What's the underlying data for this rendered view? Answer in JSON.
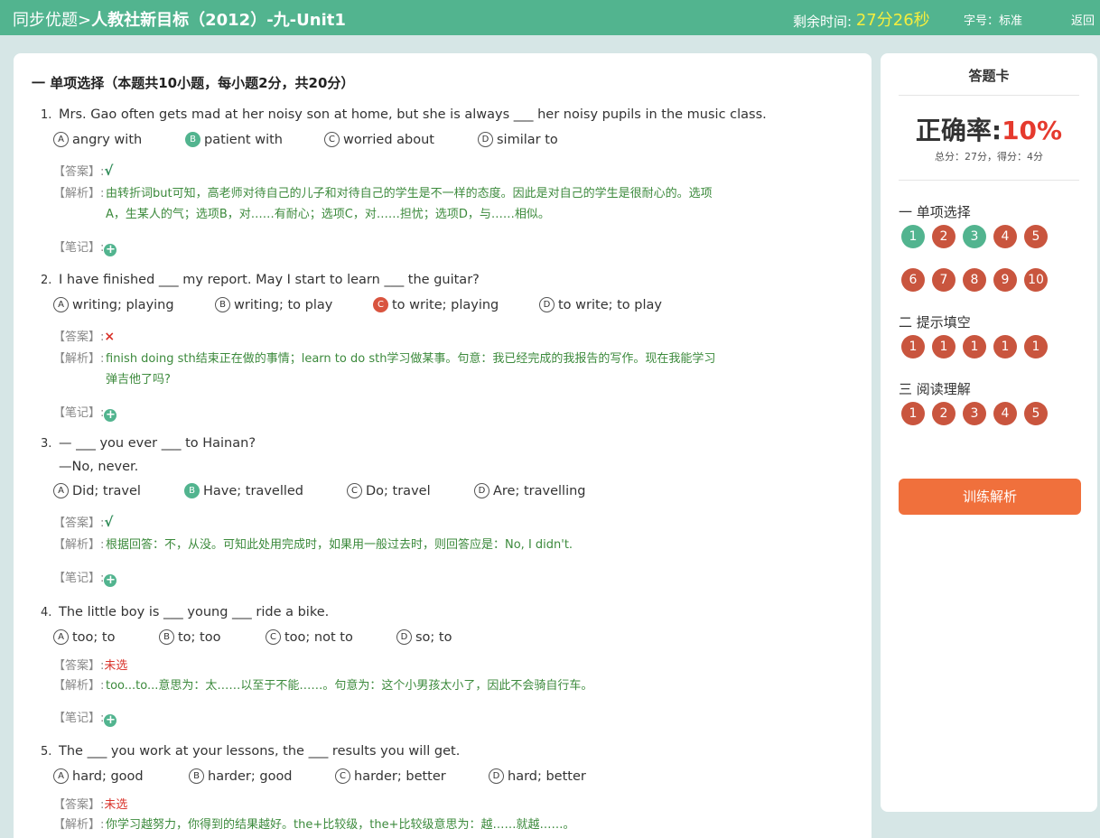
{
  "header": {
    "breadcrumb_prefix": "同步优题>",
    "breadcrumb_title": "人教社新目标（2012）-九-Unit1",
    "timer_label": "剩余时间:",
    "timer_value": "27分26秒",
    "font_size": "字号：标准",
    "back": "返回"
  },
  "section": {
    "title": "一 单项选择（本题共10小题，每小题2分，共20分）"
  },
  "labels": {
    "answer": "【答案】:",
    "analysis": "【解析】:",
    "note": "【笔记】:"
  },
  "questions": [
    {
      "num": "1.",
      "stem": "Mrs. Gao often gets mad at her noisy son at home, but she is always ___ her noisy pupils in the music class.",
      "options": [
        {
          "letter": "A",
          "text": "angry with"
        },
        {
          "letter": "B",
          "text": "patient with"
        },
        {
          "letter": "C",
          "text": "worried about"
        },
        {
          "letter": "D",
          "text": "similar to"
        }
      ],
      "answer": "√",
      "analysis_lines": [
        "由转折词but可知，高老师对待自己的儿子和对待自己的学生是不一样的态度。因此是对自己的学生是很耐心的。选项",
        "A，生某人的气；选项B，对……有耐心；选项C，对……担忧；选项D，与……相似。"
      ]
    },
    {
      "num": "2.",
      "stem": "I have finished ___ my report. May I start to learn ___ the guitar?",
      "options": [
        {
          "letter": "A",
          "text": "writing; playing"
        },
        {
          "letter": "B",
          "text": "writing; to play"
        },
        {
          "letter": "C",
          "text": "to write; playing"
        },
        {
          "letter": "D",
          "text": "to write; to play"
        }
      ],
      "answer": "×",
      "analysis_lines": [
        "finish doing sth结束正在做的事情；learn to do sth学习做某事。句意：我已经完成的我报告的写作。现在我能学习",
        "弹吉他了吗?"
      ]
    },
    {
      "num": "3.",
      "stem": "— ___ you ever ___ to Hainan?",
      "stem2": "—No, never.",
      "options": [
        {
          "letter": "A",
          "text": "Did; travel"
        },
        {
          "letter": "B",
          "text": "Have; travelled"
        },
        {
          "letter": "C",
          "text": "Do; travel"
        },
        {
          "letter": "D",
          "text": "Are; travelling"
        }
      ],
      "answer": "√",
      "analysis_lines": [
        "根据回答：不，从没。可知此处用完成时，如果用一般过去时，则回答应是：No, I didn't."
      ]
    },
    {
      "num": "4.",
      "stem": "The little boy is ___ young ___ ride a bike.",
      "options": [
        {
          "letter": "A",
          "text": "too; to"
        },
        {
          "letter": "B",
          "text": "to; too"
        },
        {
          "letter": "C",
          "text": "too; not to"
        },
        {
          "letter": "D",
          "text": "so; to"
        }
      ],
      "answer": "未选",
      "analysis_lines": [
        "too...to...意思为：太……以至于不能……。句意为：这个小男孩太小了，因此不会骑自行车。"
      ]
    },
    {
      "num": "5.",
      "stem": "The ___ you work at your lessons, the ___ results you will get.",
      "options": [
        {
          "letter": "A",
          "text": "hard; good"
        },
        {
          "letter": "B",
          "text": "harder; good"
        },
        {
          "letter": "C",
          "text": "harder; better"
        },
        {
          "letter": "D",
          "text": "hard; better"
        }
      ],
      "answer": "未选",
      "analysis_lines": [
        "你学习越努力，你得到的结果越好。the+比较级，the+比较级意思为：越……就越……。"
      ]
    }
  ],
  "card": {
    "title": "答题卡",
    "rate_label": "正确率:",
    "rate_value": "10%",
    "score": "总分：27分，得分：4分",
    "groups": [
      {
        "title": "一 单项选择",
        "items": [
          "1",
          "2",
          "3",
          "4",
          "5",
          "6",
          "7",
          "8",
          "9",
          "10"
        ]
      },
      {
        "title": "二 提示填空",
        "items": [
          "1",
          "1",
          "1",
          "1",
          "1"
        ]
      },
      {
        "title": "三 阅读理解",
        "items": [
          "1",
          "2",
          "3",
          "4",
          "5"
        ]
      }
    ],
    "analysis_button": "训练解析"
  },
  "colors": {
    "header_green": "#52b48f",
    "correct": "#52b48f",
    "wrong": "#c9553e",
    "timer": "#f5ee3e",
    "rate": "#e53a2e",
    "button": "#f0703c",
    "analysis_text": "#3c8a3c"
  }
}
